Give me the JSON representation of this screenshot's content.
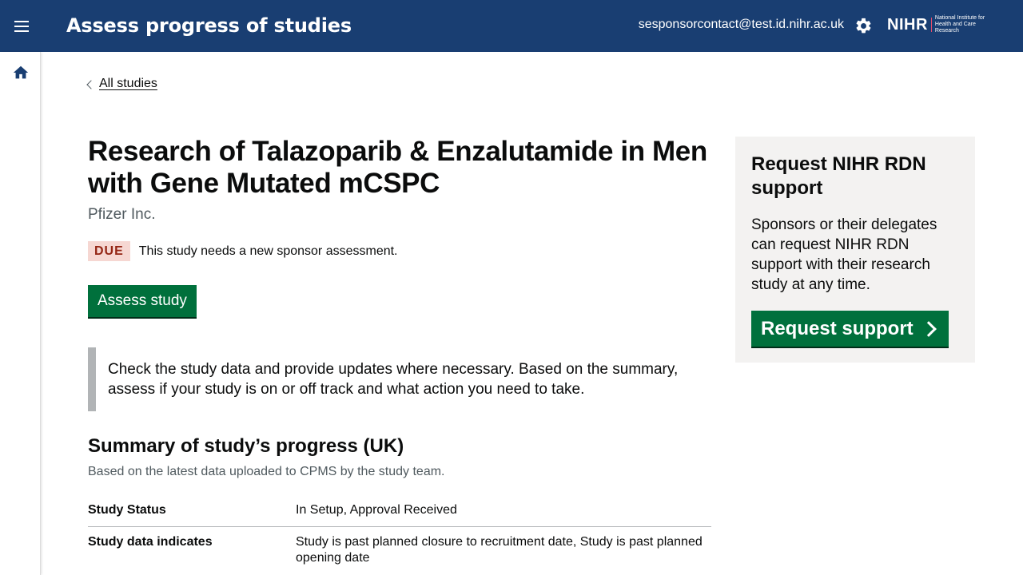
{
  "header": {
    "title": "Assess progress of studies",
    "user_email": "sesponsorcontact@test.id.nihr.ac.uk",
    "logo_short": "NIHR",
    "logo_full": "National Institute for Health and Care Research",
    "background_color": "#193e72"
  },
  "icons": {
    "menu": "menu-icon",
    "settings": "gear-icon",
    "home": "home-icon",
    "back": "chevron-left-icon",
    "support_arrow": "chevron-right-icon"
  },
  "back_link": {
    "label": "All studies"
  },
  "study": {
    "title": "Research of Talazoparib & Enzalutamide in Men with Gene Mutated mCSPC",
    "sponsor": "Pfizer Inc.",
    "status_tag": "DUE",
    "status_message": "This study needs a new sponsor assessment.",
    "assess_button_label": "Assess study"
  },
  "inset_text": "Check the study data and provide updates where necessary. Based on the summary, assess if your study is on or off track and what action you need to take.",
  "summary": {
    "heading": "Summary of study’s progress (UK)",
    "subheading": "Based on the latest data uploaded to CPMS by the study team.",
    "rows": [
      {
        "key": "Study Status",
        "value": "In Setup, Approval Received"
      },
      {
        "key": "Study data indicates",
        "value": "Study is past planned closure to recruitment date, Study is past planned opening date"
      }
    ]
  },
  "support_panel": {
    "heading": "Request NIHR RDN support",
    "body": "Sponsors or their delegates can request NIHR RDN support with their research study at any time.",
    "button_label": "Request support"
  },
  "colors": {
    "primary_button": "#00703c",
    "due_tag_bg": "#f6d7d2",
    "due_tag_text": "#942514",
    "panel_bg": "#f3f2f1"
  }
}
